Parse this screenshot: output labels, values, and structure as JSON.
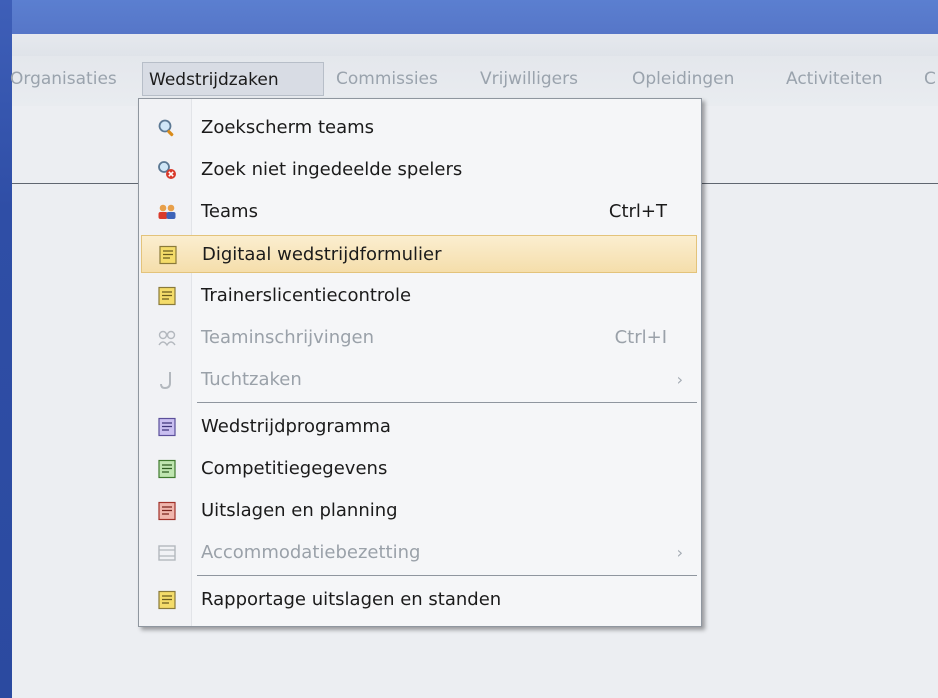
{
  "menubar": {
    "items": [
      {
        "label": "Organisaties",
        "active": false
      },
      {
        "label": "Wedstrijdzaken",
        "active": true
      },
      {
        "label": "Commissies",
        "active": false
      },
      {
        "label": "Vrijwilligers",
        "active": false
      },
      {
        "label": "Opleidingen",
        "active": false
      },
      {
        "label": "Activiteiten",
        "active": false
      },
      {
        "label": "C",
        "active": false
      }
    ]
  },
  "dropdown": {
    "items": [
      {
        "label": "Zoekscherm teams",
        "icon": "magnifier-icon"
      },
      {
        "label": "Zoek niet ingedeelde spelers",
        "icon": "search-remove-icon"
      },
      {
        "label": "Teams",
        "shortcut": "Ctrl+T",
        "icon": "people-group-icon"
      },
      {
        "label": "Digitaal wedstrijdformulier",
        "icon": "form-yellow-icon",
        "highlighted": true
      },
      {
        "label": "Trainerslicentiecontrole",
        "icon": "form-yellow-icon"
      },
      {
        "label": "Teaminschrijvingen",
        "shortcut": "Ctrl+I",
        "icon": "team-register-icon",
        "disabled": true
      },
      {
        "label": "Tuchtzaken",
        "icon": "hook-icon",
        "disabled": true,
        "submenu": true
      },
      {
        "label": "Wedstrijdprogramma",
        "icon": "form-purple-icon"
      },
      {
        "label": "Competitiegegevens",
        "icon": "form-green-icon"
      },
      {
        "label": "Uitslagen en planning",
        "icon": "form-red-icon"
      },
      {
        "label": "Accommodatiebezetting",
        "icon": "tray-icon",
        "disabled": true,
        "submenu": true
      },
      {
        "label": "Rapportage uitslagen en standen",
        "icon": "form-yellow-icon"
      }
    ],
    "submenu_arrow": "›"
  },
  "colors": {
    "highlight": "#f5deab",
    "disabled_text": "#9aa1a9",
    "menubar_inactive_text": "#9aa3ad"
  }
}
